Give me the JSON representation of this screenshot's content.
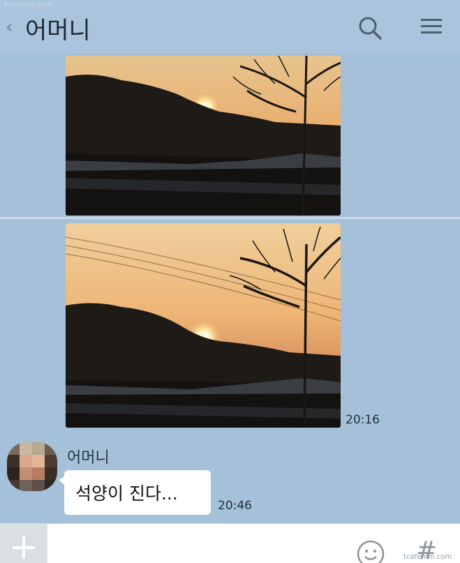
{
  "header": {
    "title": "어머니",
    "back_icon": "chevron-left-icon",
    "search_icon": "search-icon",
    "menu_icon": "hamburger-menu-icon"
  },
  "watermark": {
    "top": "tcafemm.com",
    "bottom": "tcafemm.com"
  },
  "messages": [
    {
      "type": "image",
      "description_icon": "sunset-photo"
    },
    {
      "type": "image",
      "description_icon": "sunset-photo",
      "time": "20:16"
    },
    {
      "type": "text",
      "sender": "어머니",
      "text": "석양이 진다...",
      "time": "20:46"
    }
  ],
  "input_bar": {
    "plus_icon": "plus-icon",
    "emoji_icon": "smiley-icon",
    "hash_label": "#"
  },
  "colors": {
    "background": "#a5c0d9",
    "bubble": "#ffffff"
  }
}
